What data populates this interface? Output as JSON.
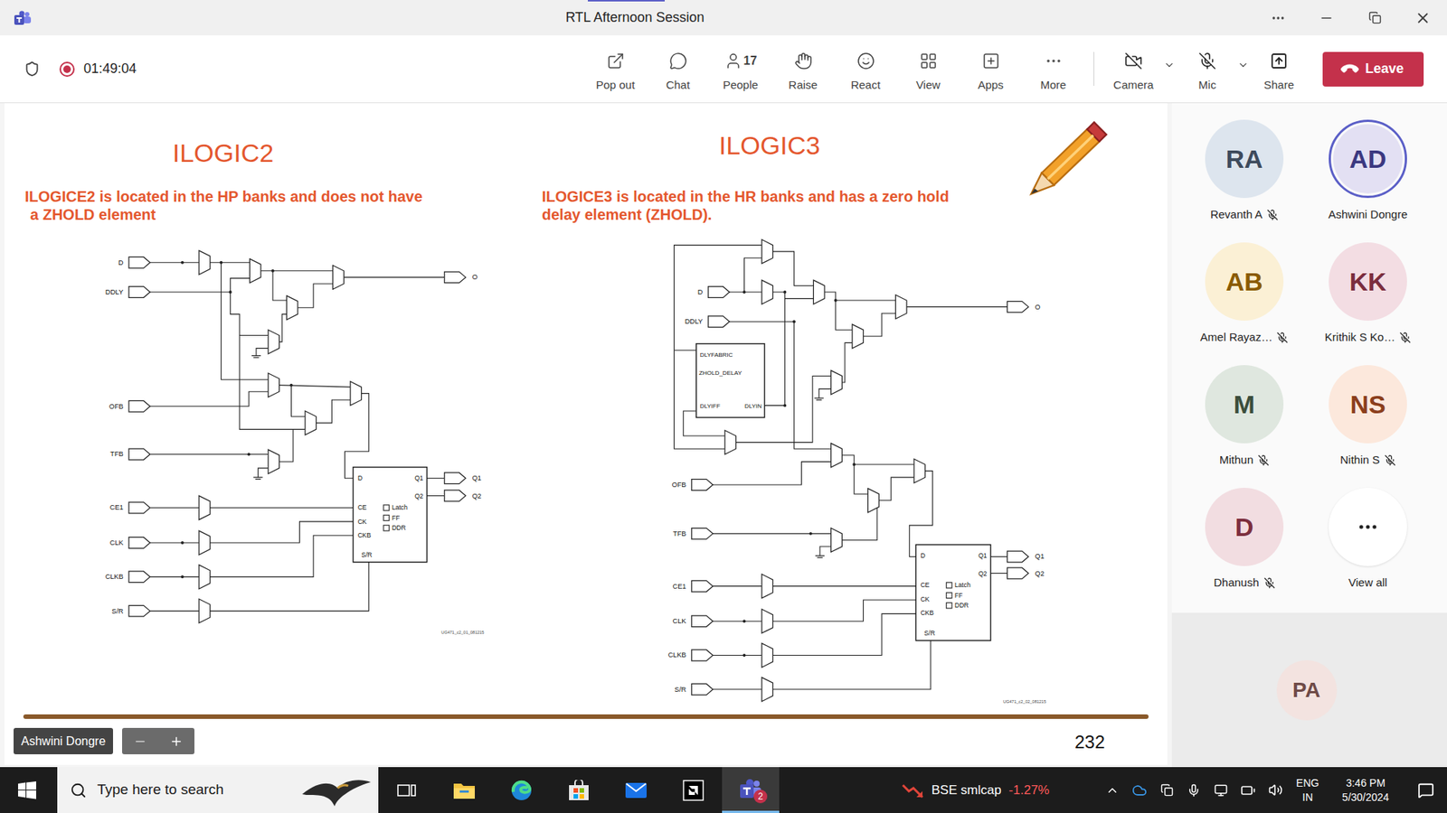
{
  "window": {
    "title": "RTL Afternoon Session"
  },
  "meeting": {
    "recording": true,
    "elapsed": "01:49:04"
  },
  "toolbar": {
    "buttons": [
      {
        "label": "Pop out"
      },
      {
        "label": "Chat"
      },
      {
        "label": "People",
        "count": "17"
      },
      {
        "label": "Raise"
      },
      {
        "label": "React"
      },
      {
        "label": "View"
      },
      {
        "label": "Apps"
      },
      {
        "label": "More"
      }
    ],
    "devices": [
      {
        "label": "Camera",
        "on": false
      },
      {
        "label": "Mic",
        "on": false
      }
    ],
    "share": {
      "label": "Share"
    },
    "leave": {
      "label": "Leave"
    }
  },
  "slide": {
    "panels": [
      {
        "title": "ILOGIC2",
        "description": [
          "ILOGICE2 is located in the HP banks and does not have",
          "a ZHOLD element"
        ],
        "diagram": {
          "inputs": [
            "D",
            "DDLY",
            "OFB",
            "TFB",
            "CE1",
            "CLK",
            "CLKB",
            "S/R"
          ],
          "output": "O",
          "outputs": [
            "Q1",
            "Q2"
          ],
          "register": {
            "inputs": [
              "D",
              "CE",
              "CK",
              "CKB"
            ],
            "outputs": [
              "Q1",
              "Q2"
            ],
            "reset": "S/R",
            "modes": [
              {
                "label": "Latch",
                "checked": false
              },
              {
                "label": "FF",
                "checked": false
              },
              {
                "label": "DDR",
                "checked": false
              }
            ]
          },
          "figure": "UG471_c2_01_081215"
        }
      },
      {
        "title": "ILOGIC3",
        "description": [
          "ILOGICE3 is located in the HR banks and has a zero hold",
          "delay element (ZHOLD)."
        ],
        "diagram": {
          "inputs": [
            "D",
            "DDLY",
            "OFB",
            "TFB",
            "CE1",
            "CLK",
            "CLKB",
            "S/R"
          ],
          "output": "O",
          "outputs": [
            "Q1",
            "Q2"
          ],
          "register": {
            "inputs": [
              "D",
              "CE",
              "CK",
              "CKB"
            ],
            "outputs": [
              "Q1",
              "Q2"
            ],
            "reset": "S/R",
            "modes": [
              {
                "label": "Latch",
                "checked": false
              },
              {
                "label": "FF",
                "checked": false
              },
              {
                "label": "DDR",
                "checked": false
              }
            ]
          },
          "delay": {
            "title": "DLYFABRIC",
            "name": "ZHOLD_DELAY",
            "ports": [
              "DLYIFF",
              "DLYIN"
            ]
          },
          "figure": "UG471_c2_02_081215"
        }
      }
    ],
    "page": "232"
  },
  "stage": {
    "presenter": "Ashwini Dongre"
  },
  "participants": [
    {
      "initials": "RA",
      "name": "Revanth A",
      "muted": true,
      "speaking": false,
      "color": "#dde5ee",
      "text_color": "#3d4a5c"
    },
    {
      "initials": "AD",
      "name": "Ashwini Dongre",
      "muted": false,
      "speaking": true,
      "color": "#e3e0f3",
      "text_color": "#3b3880"
    },
    {
      "initials": "AB",
      "name": "Amel Rayaz…",
      "muted": true,
      "speaking": false,
      "color": "#fbf0d5",
      "text_color": "#8a5b00"
    },
    {
      "initials": "KK",
      "name": "Krithik S Ko…",
      "muted": true,
      "speaking": false,
      "color": "#f3dde3",
      "text_color": "#7b2d3e"
    },
    {
      "initials": "M",
      "name": "Mithun",
      "muted": true,
      "speaking": false,
      "color": "#dfe7df",
      "text_color": "#3c4e3c"
    },
    {
      "initials": "NS",
      "name": "Nithin S",
      "muted": true,
      "speaking": false,
      "color": "#fce8dc",
      "text_color": "#8b3e1c"
    },
    {
      "initials": "D",
      "name": "Dhanush",
      "muted": true,
      "speaking": false,
      "color": "#f2dde1",
      "text_color": "#7c2e3d"
    }
  ],
  "view_all": {
    "label": "View all"
  },
  "overflow": [
    {
      "initials": "PA",
      "color": "#f3e3e0",
      "text_color": "#6e4a47"
    }
  ],
  "taskbar": {
    "search": {
      "placeholder": "Type here to search"
    },
    "apps": [
      {
        "selected": false
      },
      {
        "selected": false
      },
      {
        "selected": false
      },
      {
        "selected": false
      },
      {
        "selected": false
      },
      {
        "selected": false
      },
      {
        "selected": true,
        "badge": "2"
      }
    ],
    "widget": {
      "name": "BSE smlcap",
      "change": "-1.27%"
    },
    "language": {
      "code": "ENG",
      "region": "IN"
    },
    "clock": {
      "time": "3:46 PM",
      "date": "5/30/2024"
    }
  }
}
